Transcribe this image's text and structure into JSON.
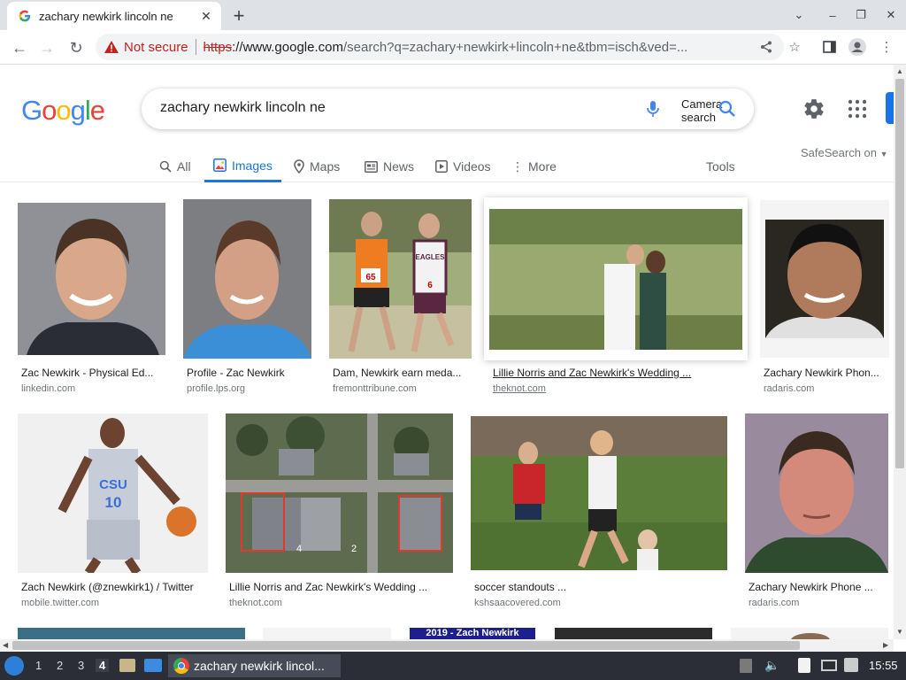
{
  "browser": {
    "tab_title": "zachary newkirk lincoln ne",
    "security_label": "Not secure",
    "url_scheme": "https",
    "url_host": "://www.google.com",
    "url_path": "/search?q=zachary+newkirk+lincoln+ne&tbm=isch&ved=..."
  },
  "google": {
    "logo": "Google",
    "query": "zachary newkirk lincoln ne",
    "camera_alt": "Camera search",
    "safesearch": "SafeSearch on",
    "tabs": [
      {
        "label": "All",
        "icon": "search-icon"
      },
      {
        "label": "Images",
        "icon": "image-icon"
      },
      {
        "label": "Maps",
        "icon": "map-pin-icon"
      },
      {
        "label": "News",
        "icon": "news-icon"
      },
      {
        "label": "Videos",
        "icon": "video-icon"
      },
      {
        "label": "More",
        "icon": "more-vert-icon"
      }
    ],
    "tools": "Tools"
  },
  "results": [
    {
      "title": "Zac Newkirk - Physical Ed...",
      "source": "linkedin.com"
    },
    {
      "title": "Profile - Zac Newkirk",
      "source": "profile.lps.org"
    },
    {
      "title": "Dam, Newkirk earn meda...",
      "source": "fremonttribune.com"
    },
    {
      "title": "Lillie Norris and Zac Newkirk's Wedding ...",
      "source": "theknot.com"
    },
    {
      "title": "Zachary Newkirk Phon...",
      "source": "radaris.com"
    },
    {
      "title": "Zach Newkirk (@znewkirk1) / Twitter",
      "source": "mobile.twitter.com"
    },
    {
      "title": "Lillie Norris and Zac Newkirk's Wedding ...",
      "source": "theknot.com"
    },
    {
      "title": "soccer standouts ...",
      "source": "kshsaacovered.com"
    },
    {
      "title": "Zachary Newkirk Phone ...",
      "source": "radaris.com"
    }
  ],
  "partial_row": {
    "banner_text": "2019 - Zach Newkirk"
  },
  "image_text": {
    "bib_1": "65",
    "bib_2": "6",
    "jersey_1": "EAGLES",
    "jersey_2": "CSU",
    "jersey_number": "10",
    "map_1": "4",
    "map_2": "2"
  },
  "taskbar": {
    "workspaces": [
      "1",
      "2",
      "3",
      "4"
    ],
    "active_workspace": "4",
    "window_title": "zachary newkirk lincol...",
    "clock": "15:55"
  }
}
